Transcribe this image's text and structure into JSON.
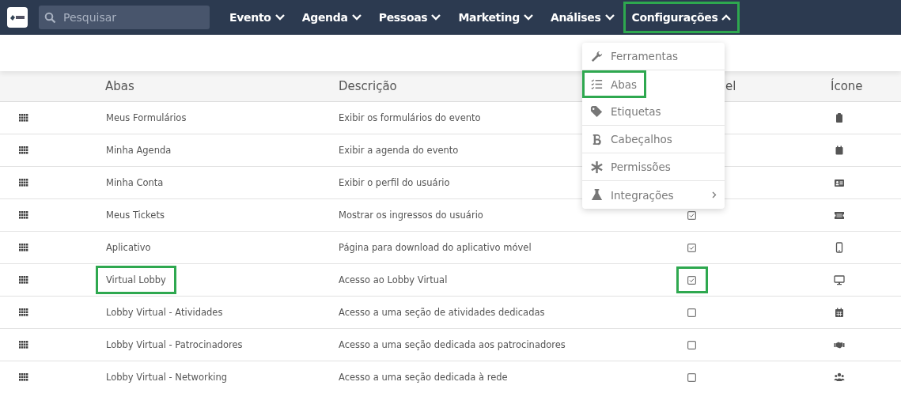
{
  "search": {
    "placeholder": "Pesquisar"
  },
  "nav": [
    {
      "label": "Evento",
      "expanded": false,
      "highlighted": false
    },
    {
      "label": "Agenda",
      "expanded": false,
      "highlighted": false
    },
    {
      "label": "Pessoas",
      "expanded": false,
      "highlighted": false
    },
    {
      "label": "Marketing",
      "expanded": false,
      "highlighted": false
    },
    {
      "label": "Análises",
      "expanded": false,
      "highlighted": false
    },
    {
      "label": "Configurações",
      "expanded": true,
      "highlighted": true
    }
  ],
  "menu": [
    {
      "label": "Ferramentas",
      "highlighted": false,
      "has_submenu": false
    },
    {
      "label": "Abas",
      "highlighted": true,
      "has_submenu": false
    },
    {
      "label": "Etiquetas",
      "highlighted": false,
      "has_submenu": false
    },
    {
      "label": "Cabeçalhos",
      "highlighted": false,
      "has_submenu": false
    },
    {
      "label": "Permissões",
      "highlighted": false,
      "has_submenu": false
    },
    {
      "label": "Integrações",
      "highlighted": false,
      "has_submenu": true
    }
  ],
  "table": {
    "columns": [
      "Abas",
      "Descrição",
      "el",
      "Ícone"
    ],
    "rows": [
      {
        "name": "Meus Formulários",
        "description": "Exibir os formulários do evento",
        "highlighted": false
      },
      {
        "name": "Minha Agenda",
        "description": "Exibir a agenda do evento",
        "highlighted": false
      },
      {
        "name": "Minha Conta",
        "description": "Exibir o perfil do usuário",
        "highlighted": false
      },
      {
        "name": "Meus Tickets",
        "description": "Mostrar os ingressos do usuário",
        "checked": true,
        "highlighted": false,
        "check_highlighted": false
      },
      {
        "name": "Aplicativo",
        "description": "Página para download do aplicativo móvel",
        "checked": true,
        "highlighted": false,
        "check_highlighted": false
      },
      {
        "name": "Virtual Lobby",
        "description": "Acesso ao Lobby Virtual",
        "checked": true,
        "highlighted": true,
        "check_highlighted": true
      },
      {
        "name": "Lobby Virtual - Atividades",
        "description": "Acesso a uma seção de atividades dedicadas",
        "checked": false,
        "highlighted": false,
        "check_highlighted": false
      },
      {
        "name": "Lobby Virtual - Patrocinadores",
        "description": "Acesso a uma seção dedicada aos patrocinadores",
        "checked": false,
        "highlighted": false,
        "check_highlighted": false
      },
      {
        "name": "Lobby Virtual - Networking",
        "description": "Acesso a uma seção dedicada à rede",
        "checked": false,
        "highlighted": false,
        "check_highlighted": false
      }
    ]
  }
}
